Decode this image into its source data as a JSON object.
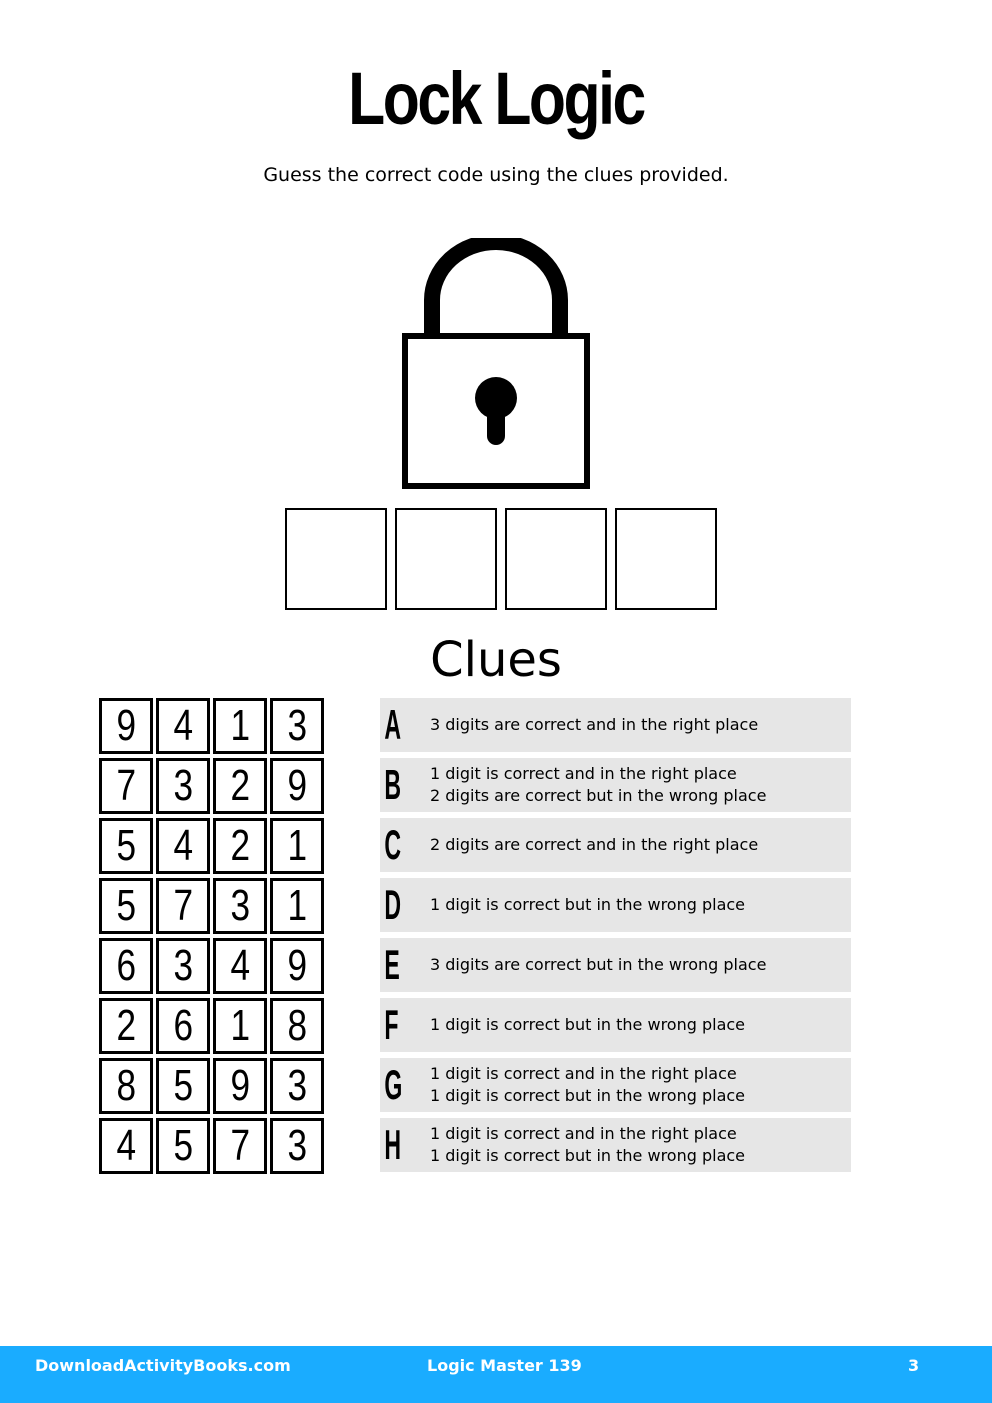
{
  "header": {
    "title": "Lock Logic",
    "subtitle": "Guess the correct code using the clues provided."
  },
  "puzzle": {
    "icon": "padlock-icon",
    "answer_boxes": [
      "",
      "",
      "",
      ""
    ],
    "clues_heading": "Clues",
    "guesses": [
      {
        "letter": "A",
        "digits": [
          "9",
          "4",
          "1",
          "3"
        ],
        "clue_lines": [
          "3 digits are correct and in the right place"
        ]
      },
      {
        "letter": "B",
        "digits": [
          "7",
          "3",
          "2",
          "9"
        ],
        "clue_lines": [
          "1 digit is correct and in the right place",
          "2 digits are correct but in the wrong place"
        ]
      },
      {
        "letter": "C",
        "digits": [
          "5",
          "4",
          "2",
          "1"
        ],
        "clue_lines": [
          "2 digits are correct and in the right place"
        ]
      },
      {
        "letter": "D",
        "digits": [
          "5",
          "7",
          "3",
          "1"
        ],
        "clue_lines": [
          "1 digit is correct but in the wrong place"
        ]
      },
      {
        "letter": "E",
        "digits": [
          "6",
          "3",
          "4",
          "9"
        ],
        "clue_lines": [
          "3 digits are correct but in the wrong place"
        ]
      },
      {
        "letter": "F",
        "digits": [
          "2",
          "6",
          "1",
          "8"
        ],
        "clue_lines": [
          "1 digit is correct but in the wrong place"
        ]
      },
      {
        "letter": "G",
        "digits": [
          "8",
          "5",
          "9",
          "3"
        ],
        "clue_lines": [
          "1 digit is correct and in the right place",
          "1 digit is correct but in the wrong place"
        ]
      },
      {
        "letter": "H",
        "digits": [
          "4",
          "5",
          "7",
          "3"
        ],
        "clue_lines": [
          "1 digit is correct and in the right place",
          "1 digit is correct but in the wrong place"
        ]
      }
    ]
  },
  "footer": {
    "site": "DownloadActivityBooks.com",
    "book": "Logic Master 139",
    "page": "3",
    "color": "#1aacff"
  }
}
